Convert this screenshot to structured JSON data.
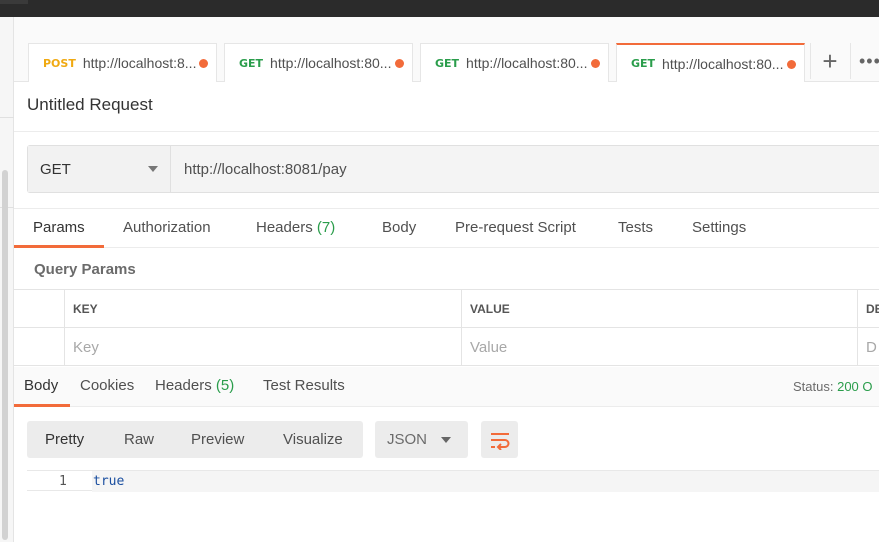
{
  "tabs": [
    {
      "method": "POST",
      "url": "http://localhost:8..."
    },
    {
      "method": "GET",
      "url": "http://localhost:80..."
    },
    {
      "method": "GET",
      "url": "http://localhost:80..."
    },
    {
      "method": "GET",
      "url": "http://localhost:80..."
    }
  ],
  "tab_actions": {
    "new_tab": "+",
    "more": "•••"
  },
  "request": {
    "title": "Untitled Request",
    "method": "GET",
    "url": "http://localhost:8081/pay"
  },
  "request_tabs": {
    "params": "Params",
    "authorization": "Authorization",
    "headers": "Headers",
    "headers_count": "(7)",
    "body": "Body",
    "prerequest": "Pre-request Script",
    "tests": "Tests",
    "settings": "Settings"
  },
  "query_params": {
    "title": "Query Params",
    "columns": {
      "key": "KEY",
      "value": "VALUE",
      "description": "DE"
    },
    "row": {
      "key_placeholder": "Key",
      "value_placeholder": "Value",
      "description_placeholder": "D"
    }
  },
  "response_tabs": {
    "body": "Body",
    "cookies": "Cookies",
    "headers": "Headers",
    "headers_count": "(5)",
    "test_results": "Test Results",
    "status_label": "Status:",
    "status_value": "200 O"
  },
  "response_view": {
    "formats": [
      "Pretty",
      "Raw",
      "Preview",
      "Visualize"
    ],
    "active_format": "Pretty",
    "language": "JSON"
  },
  "response_body": {
    "lines": [
      {
        "num": "1",
        "text": "true"
      }
    ]
  },
  "colors": {
    "accent": "#f26b3a",
    "get": "#2a9d4b",
    "post": "#f0a911",
    "status_ok": "#2a9d4b"
  }
}
